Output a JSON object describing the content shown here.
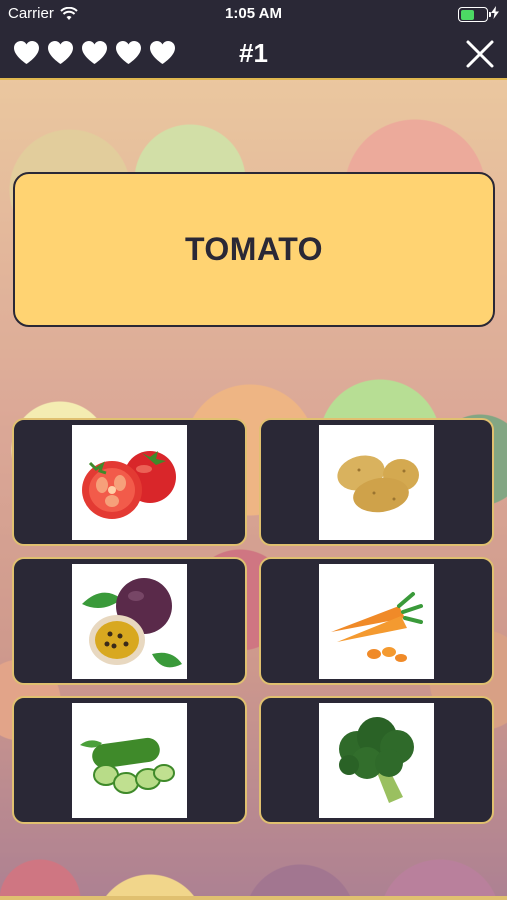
{
  "status_bar": {
    "carrier": "Carrier",
    "time": "1:05 AM",
    "battery_level": 0.55
  },
  "nav": {
    "lives": 5,
    "level_label": "#1",
    "icons": {
      "life": "heart-icon",
      "close": "close-icon"
    }
  },
  "question": {
    "word": "TOMATO"
  },
  "options": [
    {
      "item": "tomato",
      "icon": "tomato-icon"
    },
    {
      "item": "potato",
      "icon": "potato-icon"
    },
    {
      "item": "passion fruit",
      "icon": "passion-fruit-icon"
    },
    {
      "item": "carrot",
      "icon": "carrot-icon"
    },
    {
      "item": "cucumber",
      "icon": "cucumber-icon"
    },
    {
      "item": "broccoli",
      "icon": "broccoli-icon"
    }
  ],
  "colors": {
    "bar_background": "#2a2836",
    "accent_yellow": "#ffd372",
    "tile_border": "#e0c070",
    "battery_green": "#4cd964"
  }
}
